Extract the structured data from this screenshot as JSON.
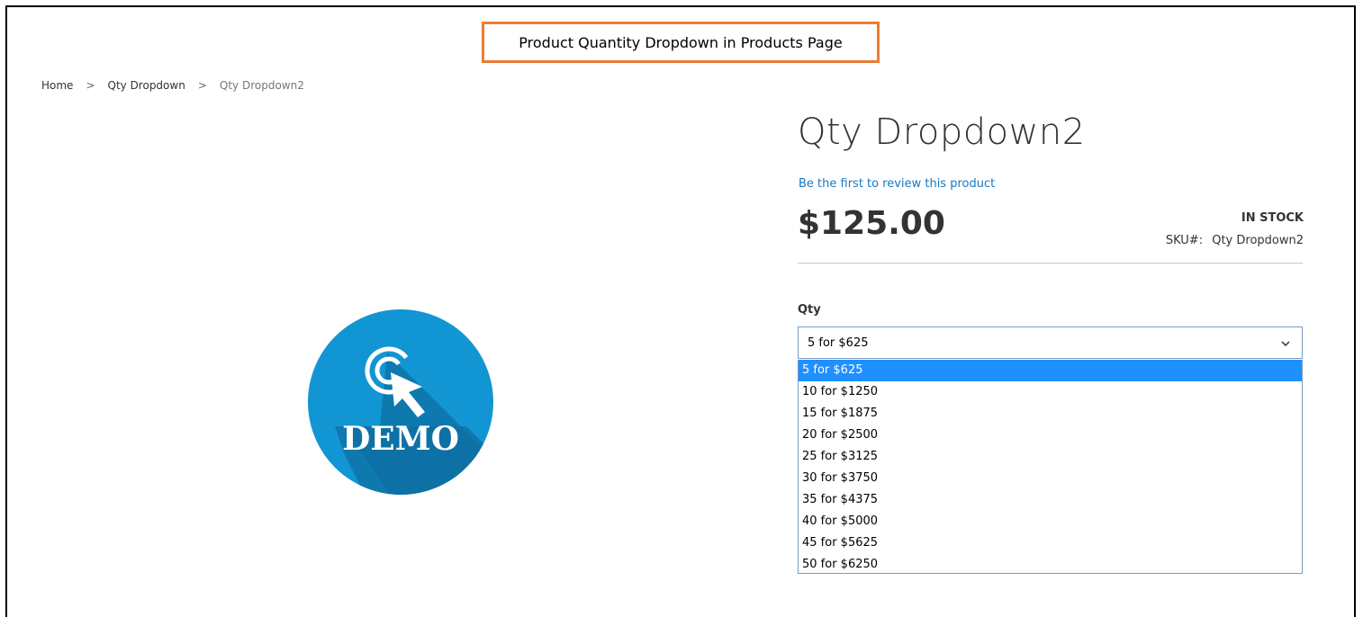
{
  "callout": {
    "text": "Product Quantity Dropdown in Products Page",
    "border_color": "#ED7D31"
  },
  "breadcrumb": {
    "items": [
      {
        "label": "Home"
      },
      {
        "label": "Qty Dropdown"
      },
      {
        "label": "Qty Dropdown2"
      }
    ],
    "separator": ">"
  },
  "product": {
    "image_text": "DEMO",
    "image_color": "#1296D3",
    "title": "Qty Dropdown2",
    "review_link": "Be the first to review this product",
    "price": "$125.00",
    "stock_status": "IN STOCK",
    "sku_label": "SKU#:",
    "sku_value": "Qty Dropdown2"
  },
  "qty": {
    "label": "Qty",
    "selected": "5 for $625",
    "options": [
      "5 for $625",
      "10 for $1250",
      "15 for $1875",
      "20 for $2500",
      "25 for $3125",
      "30 for $3750",
      "35 for $4375",
      "40 for $5000",
      "45 for $5625",
      "50 for $6250"
    ],
    "highlight_color": "#1E90FF"
  }
}
